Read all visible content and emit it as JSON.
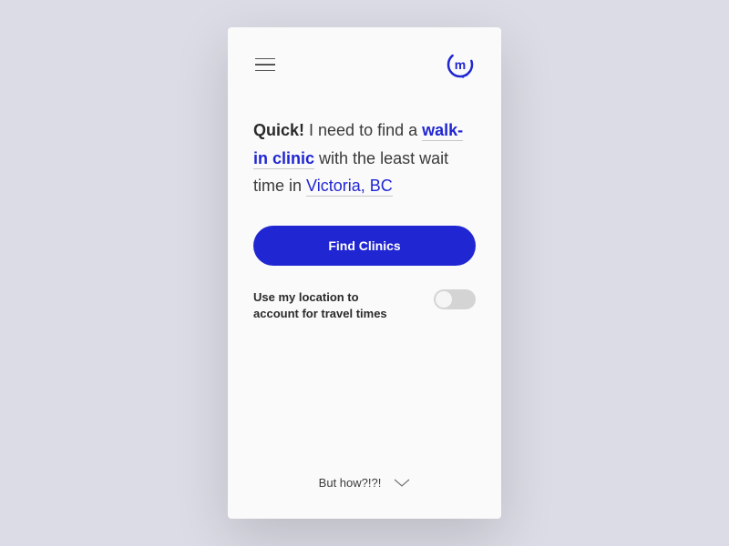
{
  "colors": {
    "accent": "#2026d2",
    "background": "#dcdce6",
    "surface": "#fafafa"
  },
  "logo": {
    "letter": "m"
  },
  "prompt": {
    "bold_prefix": "Quick!",
    "text1": " I need to find a ",
    "clinic_type": "walk-in clinic",
    "text2": " with the least wait time in ",
    "location": "Victoria, BC"
  },
  "cta": {
    "find_label": "Find Clinics"
  },
  "toggle": {
    "label": "Use my location to account for travel times",
    "state": "off"
  },
  "footer": {
    "hint": "But how?!?!"
  }
}
